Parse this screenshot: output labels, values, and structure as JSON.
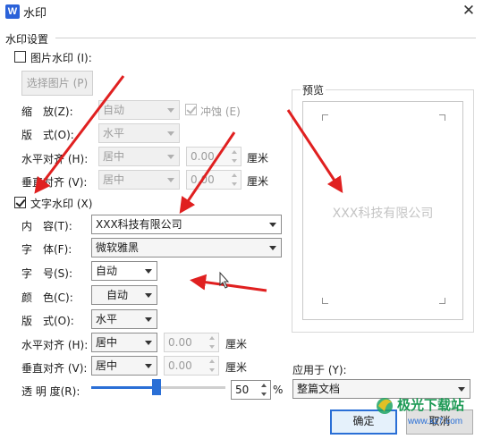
{
  "window": {
    "app_icon": "W",
    "title": "水印",
    "close_symbol": "✕"
  },
  "group": {
    "label": "水印设置"
  },
  "picture": {
    "label": "图片水印 (I):",
    "checked": false,
    "select_button": "选择图片 (P)",
    "scale_label": "缩　放(Z):",
    "scale_value": "自动",
    "washout_label": "冲蚀 (E)",
    "layout_label": "版　式(O):",
    "layout_value": "水平",
    "halign_label": "水平对齐 (H):",
    "halign_value": "居中",
    "halign_offset": "0.00",
    "halign_unit": "厘米",
    "valign_label": "垂直对齐 (V):",
    "valign_value": "居中",
    "valign_offset": "0.00",
    "valign_unit": "厘米"
  },
  "text_wm": {
    "label": "文字水印 (X)",
    "checked": true,
    "content_label": "内　容(T):",
    "content_value": "XXX科技有限公司",
    "font_label": "字　体(F):",
    "font_value": "微软雅黑",
    "size_label": "字　号(S):",
    "size_value": "自动",
    "color_label": "颜　色(C):",
    "color_value": "自动",
    "layout_label": "版　式(O):",
    "layout_value": "水平",
    "halign_label": "水平对齐 (H):",
    "halign_value": "居中",
    "halign_offset": "0.00",
    "halign_unit": "厘米",
    "valign_label": "垂直对齐 (V):",
    "valign_value": "居中",
    "valign_offset": "0.00",
    "valign_unit": "厘米",
    "transparency_label": "透 明 度(R):",
    "transparency_value": "50",
    "transparency_unit": "%",
    "transparency_level": 0.5
  },
  "preview": {
    "label": "预览",
    "watermark_text": "XXX科技有限公司"
  },
  "apply": {
    "label": "应用于 (Y):",
    "value": "整篇文档"
  },
  "buttons": {
    "ok": "确定",
    "cancel": "取消"
  },
  "branding": {
    "name": "极光下载站",
    "url": "www.xz7.com"
  },
  "colors": {
    "accent": "#2a6fd6",
    "arrow": "#e02020",
    "app_icon": "#2b62d9",
    "watermark_preview": "#c4c4c4"
  }
}
